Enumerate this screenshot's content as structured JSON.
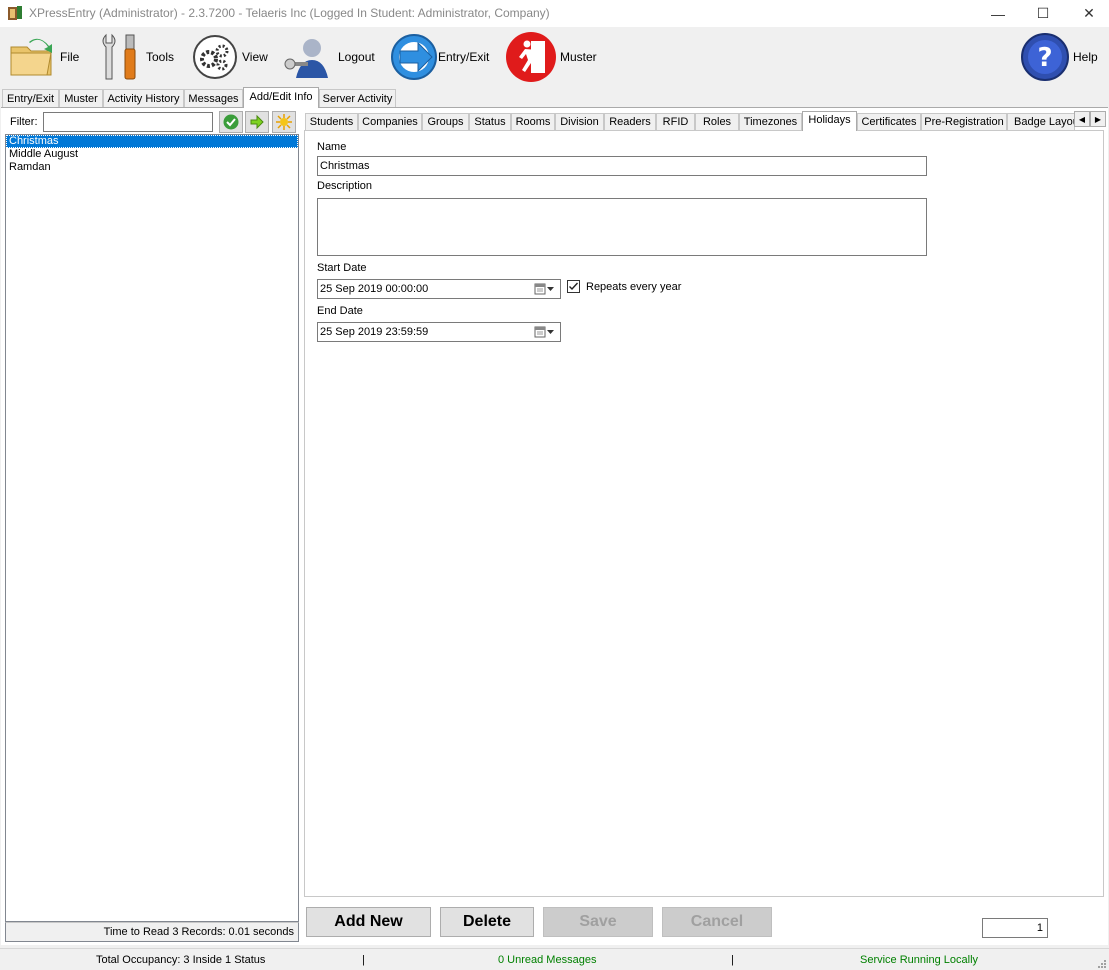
{
  "window": {
    "title": "XPressEntry (Administrator)  - 2.3.7200 - Telaeris Inc (Logged In Student: Administrator, Company)",
    "minimize": "—",
    "maximize": "☐",
    "close": "✕"
  },
  "toolbar": {
    "file": "File",
    "tools": "Tools",
    "view": "View",
    "logout": "Logout",
    "entry_exit": "Entry/Exit",
    "muster": "Muster",
    "help": "Help"
  },
  "main_tabs": [
    "Entry/Exit",
    "Muster",
    "Activity History",
    "Messages",
    "Add/Edit Info",
    "Server Activity"
  ],
  "left_panel": {
    "filter_label": "Filter:",
    "filter_value": "",
    "records": [
      "Christmas",
      "Middle August",
      "Ramdan"
    ],
    "selected_index": 0,
    "status": "Time to Read 3 Records: 0.01 seconds"
  },
  "sub_tabs": [
    "Students",
    "Companies",
    "Groups",
    "Status",
    "Rooms",
    "Division",
    "Readers",
    "RFID",
    "Roles",
    "Timezones",
    "Holidays",
    "Certificates",
    "Pre-Registration",
    "Badge Layout"
  ],
  "sub_tab_scroll": {
    "left": "◀",
    "right": "▶"
  },
  "form": {
    "name_label": "Name",
    "name_value": "Christmas",
    "description_label": "Description",
    "description_value": "",
    "start_date_label": "Start Date",
    "start_date_value": "25 Sep  2019 00:00:00",
    "repeats_label": "Repeats every year",
    "repeats_checked": true,
    "end_date_label": "End Date",
    "end_date_value": "25 Sep  2019 23:59:59"
  },
  "buttons": {
    "add_new": "Add New",
    "delete": "Delete",
    "save": "Save",
    "cancel": "Cancel"
  },
  "page_number": "1",
  "status_bar": {
    "occupancy": "Total Occupancy: 3 Inside 1 Status",
    "separator": "|",
    "messages": "0 Unread Messages",
    "service": "Service Running Locally"
  },
  "colors": {
    "selection": "#0078d7",
    "status_green": "#008000"
  }
}
